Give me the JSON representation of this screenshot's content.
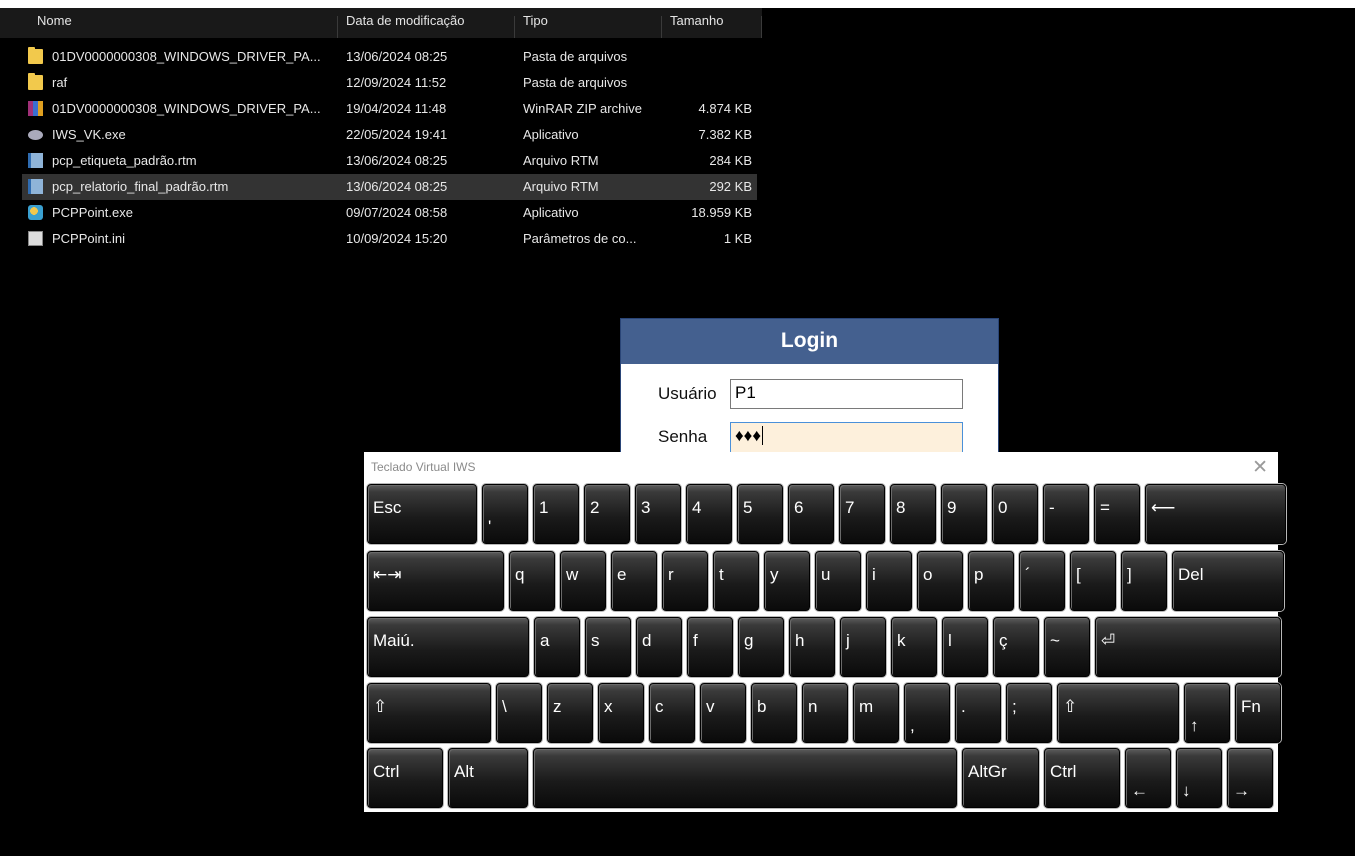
{
  "explorer": {
    "columns": [
      "Nome",
      "Data de modificação",
      "Tipo",
      "Tamanho"
    ],
    "files": [
      {
        "name": "01DV0000000308_WINDOWS_DRIVER_PA...",
        "date": "13/06/2024 08:25",
        "type": "Pasta de arquivos",
        "size": "",
        "icon": "folder-icon",
        "selected": false
      },
      {
        "name": "raf",
        "date": "12/09/2024 11:52",
        "type": "Pasta de arquivos",
        "size": "",
        "icon": "folder-icon",
        "selected": false
      },
      {
        "name": "01DV0000000308_WINDOWS_DRIVER_PA...",
        "date": "19/04/2024 11:48",
        "type": "WinRAR ZIP archive",
        "size": "4.874 KB",
        "icon": "winrar-archive-icon",
        "selected": false
      },
      {
        "name": "IWS_VK.exe",
        "date": "22/05/2024 19:41",
        "type": "Aplicativo",
        "size": "7.382 KB",
        "icon": "application-icon",
        "selected": false
      },
      {
        "name": "pcp_etiqueta_padrão.rtm",
        "date": "13/06/2024 08:25",
        "type": "Arquivo RTM",
        "size": "284 KB",
        "icon": "rtm-file-icon",
        "selected": false
      },
      {
        "name": "pcp_relatorio_final_padrão.rtm",
        "date": "13/06/2024 08:25",
        "type": "Arquivo RTM",
        "size": "292 KB",
        "icon": "rtm-file-icon",
        "selected": true
      },
      {
        "name": "PCPPoint.exe",
        "date": "09/07/2024 08:58",
        "type": "Aplicativo",
        "size": "18.959 KB",
        "icon": "pcppoint-app-icon",
        "selected": false
      },
      {
        "name": "PCPPoint.ini",
        "date": "10/09/2024 15:20",
        "type": "Parâmetros de co...",
        "size": "1 KB",
        "icon": "ini-file-icon",
        "selected": false
      }
    ]
  },
  "login": {
    "title": "Login",
    "user_label": "Usuário",
    "user_value": "P1",
    "password_label": "Senha",
    "password_value": "♦♦♦"
  },
  "keyboard": {
    "title": "Teclado Virtual IWS",
    "close_glyph": "✕",
    "rows": [
      [
        {
          "label": "Esc",
          "w": 110,
          "name": "key-esc"
        },
        {
          "label": "'",
          "w": 46,
          "name": "key-apostrophe",
          "low": true
        },
        {
          "label": "1",
          "w": 46,
          "name": "key-1"
        },
        {
          "label": "2",
          "w": 46,
          "name": "key-2"
        },
        {
          "label": "3",
          "w": 46,
          "name": "key-3"
        },
        {
          "label": "4",
          "w": 46,
          "name": "key-4"
        },
        {
          "label": "5",
          "w": 46,
          "name": "key-5"
        },
        {
          "label": "6",
          "w": 46,
          "name": "key-6"
        },
        {
          "label": "7",
          "w": 46,
          "name": "key-7"
        },
        {
          "label": "8",
          "w": 46,
          "name": "key-8"
        },
        {
          "label": "9",
          "w": 46,
          "name": "key-9"
        },
        {
          "label": "0",
          "w": 46,
          "name": "key-0"
        },
        {
          "label": "-",
          "w": 46,
          "name": "key-minus"
        },
        {
          "label": "=",
          "w": 46,
          "name": "key-equals"
        },
        {
          "label": "⟵",
          "w": 141,
          "name": "key-backspace",
          "icon": "backspace-icon"
        }
      ],
      [
        {
          "label": "⇤⇥",
          "w": 137,
          "name": "key-tab",
          "icon": "tab-icon"
        },
        {
          "label": "q",
          "w": 46,
          "name": "key-q"
        },
        {
          "label": "w",
          "w": 46,
          "name": "key-w"
        },
        {
          "label": "e",
          "w": 46,
          "name": "key-e"
        },
        {
          "label": "r",
          "w": 46,
          "name": "key-r"
        },
        {
          "label": "t",
          "w": 46,
          "name": "key-t"
        },
        {
          "label": "y",
          "w": 46,
          "name": "key-y"
        },
        {
          "label": "u",
          "w": 46,
          "name": "key-u"
        },
        {
          "label": "i",
          "w": 46,
          "name": "key-i"
        },
        {
          "label": "o",
          "w": 46,
          "name": "key-o"
        },
        {
          "label": "p",
          "w": 46,
          "name": "key-p"
        },
        {
          "label": "´",
          "w": 46,
          "name": "key-acute"
        },
        {
          "label": "[",
          "w": 46,
          "name": "key-open-bracket"
        },
        {
          "label": "]",
          "w": 46,
          "name": "key-close-bracket"
        },
        {
          "label": "Del",
          "w": 112,
          "name": "key-del"
        }
      ],
      [
        {
          "label": "Maiú.",
          "w": 162,
          "name": "key-capslock"
        },
        {
          "label": "a",
          "w": 46,
          "name": "key-a"
        },
        {
          "label": "s",
          "w": 46,
          "name": "key-s"
        },
        {
          "label": "d",
          "w": 46,
          "name": "key-d"
        },
        {
          "label": "f",
          "w": 46,
          "name": "key-f"
        },
        {
          "label": "g",
          "w": 46,
          "name": "key-g"
        },
        {
          "label": "h",
          "w": 46,
          "name": "key-h"
        },
        {
          "label": "j",
          "w": 46,
          "name": "key-j"
        },
        {
          "label": "k",
          "w": 46,
          "name": "key-k"
        },
        {
          "label": "l",
          "w": 46,
          "name": "key-l"
        },
        {
          "label": "ç",
          "w": 46,
          "name": "key-c-cedilla"
        },
        {
          "label": "~",
          "w": 46,
          "name": "key-tilde"
        },
        {
          "label": "⏎",
          "w": 186,
          "name": "key-enter",
          "icon": "enter-icon"
        }
      ],
      [
        {
          "label": "⇧",
          "w": 124,
          "name": "key-left-shift",
          "icon": "shift-icon"
        },
        {
          "label": "\\",
          "w": 46,
          "name": "key-backslash"
        },
        {
          "label": "z",
          "w": 46,
          "name": "key-z"
        },
        {
          "label": "x",
          "w": 46,
          "name": "key-x"
        },
        {
          "label": "c",
          "w": 46,
          "name": "key-c"
        },
        {
          "label": "v",
          "w": 46,
          "name": "key-v"
        },
        {
          "label": "b",
          "w": 46,
          "name": "key-b"
        },
        {
          "label": "n",
          "w": 46,
          "name": "key-n"
        },
        {
          "label": "m",
          "w": 46,
          "name": "key-m"
        },
        {
          "label": ",",
          "w": 46,
          "name": "key-comma",
          "low": true
        },
        {
          "label": ".",
          "w": 46,
          "name": "key-period"
        },
        {
          "label": ";",
          "w": 46,
          "name": "key-semicolon"
        },
        {
          "label": "⇧",
          "w": 122,
          "name": "key-right-shift",
          "icon": "shift-icon"
        },
        {
          "label": "↑",
          "w": 46,
          "name": "key-arrow-up",
          "icon": "arrow-up-icon",
          "low": true
        },
        {
          "label": "Fn",
          "w": 46,
          "name": "key-fn"
        }
      ],
      [
        {
          "label": "Ctrl",
          "w": 76,
          "name": "key-left-ctrl"
        },
        {
          "label": "Alt",
          "w": 80,
          "name": "key-alt"
        },
        {
          "label": "",
          "w": 424,
          "name": "key-space"
        },
        {
          "label": "AltGr",
          "w": 77,
          "name": "key-altgr"
        },
        {
          "label": "Ctrl",
          "w": 76,
          "name": "key-right-ctrl"
        },
        {
          "label": "←",
          "w": 46,
          "name": "key-arrow-left",
          "icon": "arrow-left-icon",
          "low": true
        },
        {
          "label": "↓",
          "w": 46,
          "name": "key-arrow-down",
          "icon": "arrow-down-icon",
          "low": true
        },
        {
          "label": "→",
          "w": 46,
          "name": "key-arrow-right",
          "icon": "arrow-right-icon",
          "low": true
        }
      ]
    ]
  }
}
